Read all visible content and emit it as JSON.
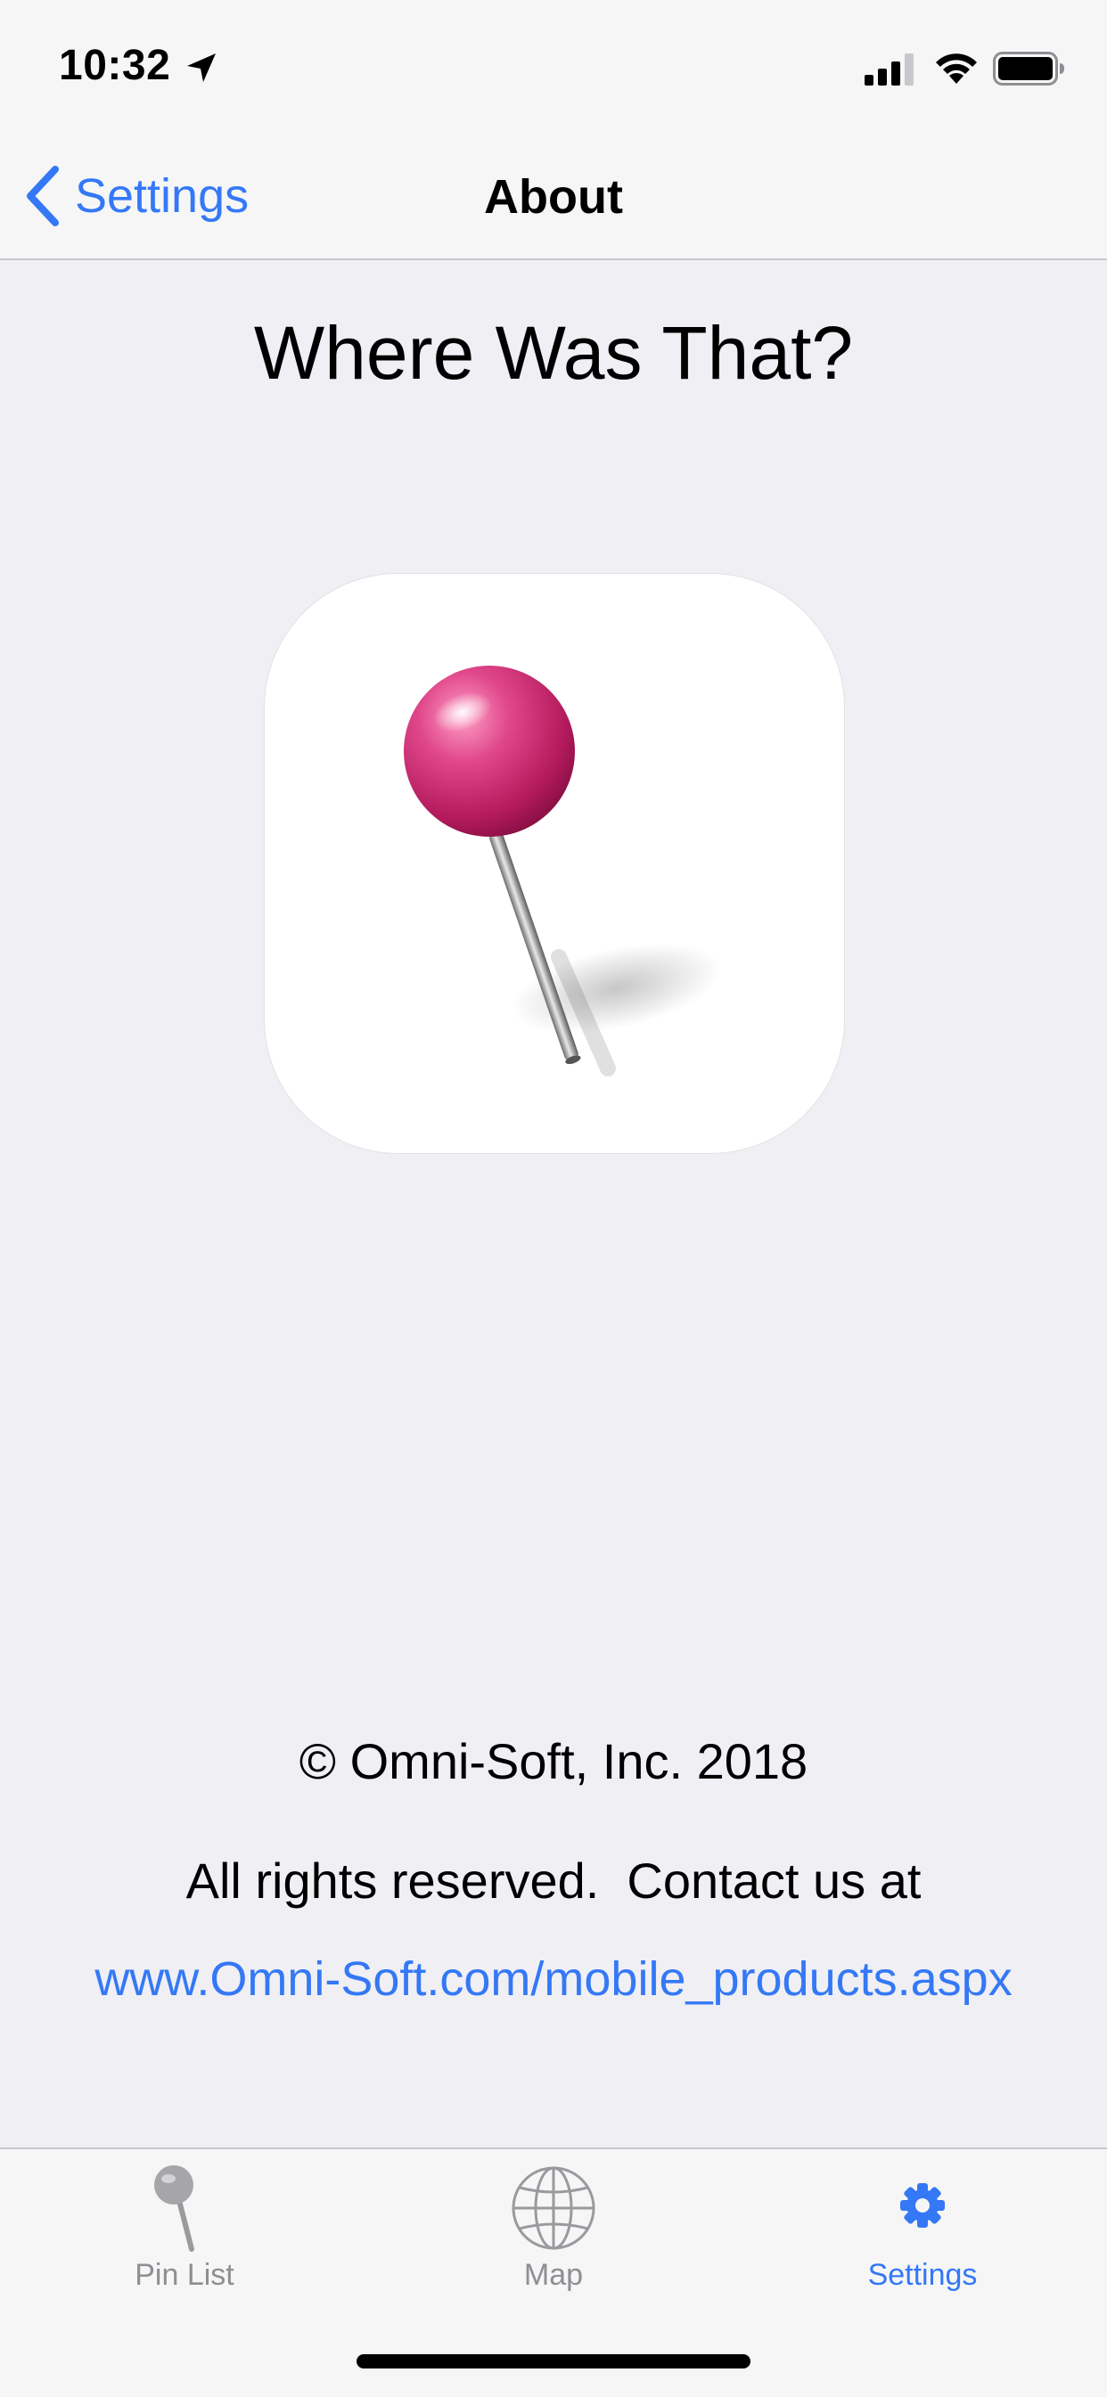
{
  "status_bar": {
    "time": "10:32"
  },
  "nav": {
    "back_label": "Settings",
    "title": "About"
  },
  "content": {
    "app_title": "Where Was That?",
    "copyright": "© Omni-Soft, Inc. 2018",
    "rights": "All rights reserved.  Contact us at",
    "website": "www.Omni-Soft.com/mobile_products.aspx"
  },
  "tab_bar": {
    "tabs": [
      {
        "label": "Pin List",
        "icon": "pin-icon"
      },
      {
        "label": "Map",
        "icon": "globe-icon"
      },
      {
        "label": "Settings",
        "icon": "gear-icon",
        "active": true
      }
    ]
  },
  "colors": {
    "accent": "#3478f6",
    "background": "#efeff4",
    "bar": "#f6f6f7",
    "pin_head": "#d83b7d"
  }
}
